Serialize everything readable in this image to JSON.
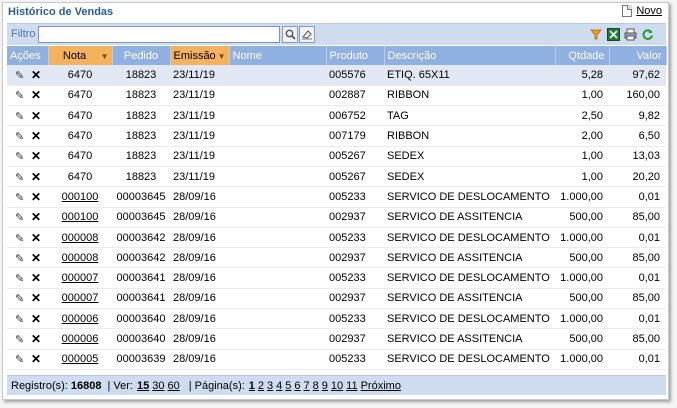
{
  "title": "Histórico de Vendas",
  "novo_label": "Novo",
  "filter": {
    "label": "Filtro",
    "value": ""
  },
  "columns": [
    "Ações",
    "Nota",
    "Pedido",
    "Emissão",
    "Nome",
    "Produto",
    "Descrição",
    "Qtdade",
    "Valor"
  ],
  "rows": [
    {
      "nota": "6470",
      "pedido": "18823",
      "emissao": "23/11/19",
      "nome": "",
      "produto": "005576",
      "descricao": "ETIQ. 65X11",
      "qtdade": "5,28",
      "valor": "97,62",
      "link": false,
      "selected": true
    },
    {
      "nota": "6470",
      "pedido": "18823",
      "emissao": "23/11/19",
      "nome": "",
      "produto": "002887",
      "descricao": "RIBBON",
      "qtdade": "1,00",
      "valor": "160,00",
      "link": false
    },
    {
      "nota": "6470",
      "pedido": "18823",
      "emissao": "23/11/19",
      "nome": "",
      "produto": "006752",
      "descricao": "TAG",
      "qtdade": "2,50",
      "valor": "9,82",
      "link": false
    },
    {
      "nota": "6470",
      "pedido": "18823",
      "emissao": "23/11/19",
      "nome": "",
      "produto": "007179",
      "descricao": "RIBBON",
      "qtdade": "2,00",
      "valor": "6,50",
      "link": false
    },
    {
      "nota": "6470",
      "pedido": "18823",
      "emissao": "23/11/19",
      "nome": "",
      "produto": "005267",
      "descricao": "SEDEX",
      "qtdade": "1,00",
      "valor": "13,03",
      "link": false
    },
    {
      "nota": "6470",
      "pedido": "18823",
      "emissao": "23/11/19",
      "nome": "",
      "produto": "005267",
      "descricao": "SEDEX",
      "qtdade": "1,00",
      "valor": "20,20",
      "link": false
    },
    {
      "nota": "000100",
      "pedido": "00003645",
      "emissao": "28/09/16",
      "nome": "",
      "produto": "005233",
      "descricao": "SERVICO DE DESLOCAMENTO",
      "qtdade": "1.000,00",
      "valor": "0,01",
      "link": true
    },
    {
      "nota": "000100",
      "pedido": "00003645",
      "emissao": "28/09/16",
      "nome": "",
      "produto": "002937",
      "descricao": "SERVICO DE ASSITENCIA",
      "qtdade": "500,00",
      "valor": "85,00",
      "link": true
    },
    {
      "nota": "000008",
      "pedido": "00003642",
      "emissao": "28/09/16",
      "nome": "",
      "produto": "005233",
      "descricao": "SERVICO DE DESLOCAMENTO",
      "qtdade": "1.000,00",
      "valor": "0,01",
      "link": true
    },
    {
      "nota": "000008",
      "pedido": "00003642",
      "emissao": "28/09/16",
      "nome": "",
      "produto": "002937",
      "descricao": "SERVICO DE ASSITENCIA",
      "qtdade": "500,00",
      "valor": "85,00",
      "link": true
    },
    {
      "nota": "000007",
      "pedido": "00003641",
      "emissao": "28/09/16",
      "nome": "",
      "produto": "005233",
      "descricao": "SERVICO DE DESLOCAMENTO",
      "qtdade": "1.000,00",
      "valor": "0,01",
      "link": true
    },
    {
      "nota": "000007",
      "pedido": "00003641",
      "emissao": "28/09/16",
      "nome": "",
      "produto": "002937",
      "descricao": "SERVICO DE ASSITENCIA",
      "qtdade": "500,00",
      "valor": "85,00",
      "link": true
    },
    {
      "nota": "000006",
      "pedido": "00003640",
      "emissao": "28/09/16",
      "nome": "",
      "produto": "005233",
      "descricao": "SERVICO DE DESLOCAMENTO",
      "qtdade": "1.000,00",
      "valor": "0,01",
      "link": true
    },
    {
      "nota": "000006",
      "pedido": "00003640",
      "emissao": "28/09/16",
      "nome": "",
      "produto": "002937",
      "descricao": "SERVICO DE ASSITENCIA",
      "qtdade": "500,00",
      "valor": "85,00",
      "link": true
    },
    {
      "nota": "000005",
      "pedido": "00003639",
      "emissao": "28/09/16",
      "nome": "",
      "produto": "005233",
      "descricao": "SERVICO DE DESLOCAMENTO",
      "qtdade": "1.000,00",
      "valor": "0,01",
      "link": true
    }
  ],
  "footer": {
    "registros_label": "Registro(s):",
    "registros_count": "16808",
    "ver_label": "| Ver:",
    "ver_options": [
      "15",
      "30",
      "60"
    ],
    "pagina_label": "| Página(s):",
    "pages": [
      "1",
      "2",
      "3",
      "4",
      "5",
      "6",
      "7",
      "8",
      "9",
      "10",
      "11"
    ],
    "next_label": "Próximo"
  },
  "colors": {
    "header_bg": "#8fb0e0",
    "sorted_header_bg": "#f5b25c",
    "title": "#2a5d9a",
    "bar_bg": "#cfdcf0"
  },
  "icons": [
    "search-icon",
    "eraser-icon",
    "filter-icon",
    "excel-icon",
    "print-icon",
    "refresh-icon",
    "edit-pencil-icon",
    "delete-x-icon",
    "document-icon"
  ]
}
